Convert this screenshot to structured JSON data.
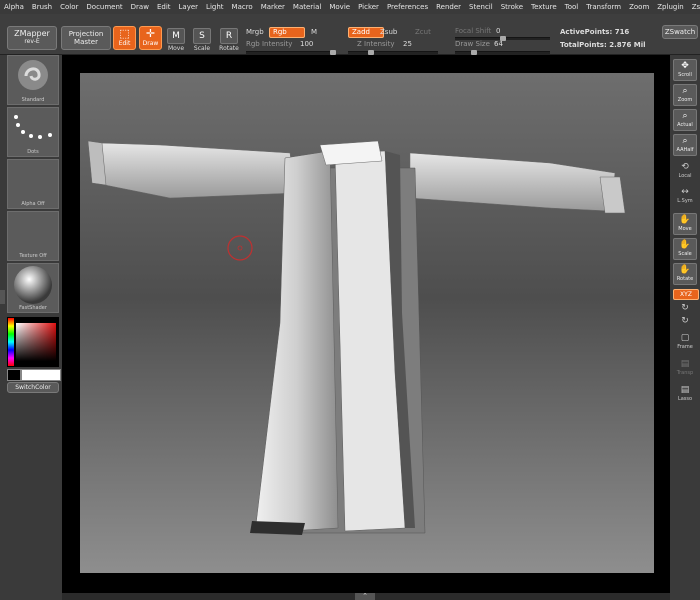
{
  "menu": [
    "Alpha",
    "Brush",
    "Color",
    "Document",
    "Draw",
    "Edit",
    "Layer",
    "Light",
    "Macro",
    "Marker",
    "Material",
    "Movie",
    "Picker",
    "Preferences",
    "Render",
    "Stencil",
    "Stroke",
    "Texture",
    "Tool",
    "Transform",
    "Zoom",
    "Zplugin",
    "Zscript"
  ],
  "toolbar": {
    "zmapper": "ZMapper",
    "zmapper_sub": "rev-E",
    "projection": "Projection",
    "projection_sub": "Master",
    "edit": "Edit",
    "draw": "Draw",
    "move": "Move",
    "scale": "Scale",
    "rotate": "Rotate",
    "mrgb": "Mrgb",
    "rgb": "Rgb",
    "m": "M",
    "rgb_intensity_label": "Rgb Intensity",
    "rgb_intensity_value": "100",
    "rgb_intensity_level": 1.0,
    "zadd": "Zadd",
    "zsub": "Zsub",
    "zcut": "Zcut",
    "z_intensity_label": "Z Intensity",
    "z_intensity_value": "25",
    "z_intensity_level": 0.25,
    "focal_shift_label": "Focal Shift",
    "focal_shift_value": "0",
    "focal_shift_level": 0.5,
    "draw_size_label": "Draw Size",
    "draw_size_value": "64",
    "draw_size_level": 0.2,
    "active_points": "ActivePoints: 716",
    "total_points": "TotalPoints: 2.876 Mil",
    "zswatch": "ZSwatch"
  },
  "left": {
    "standard": "Standard",
    "dots": "Dots",
    "alpha_off": "Alpha Off",
    "texture_off": "Texture Off",
    "fastshader": "FastShader",
    "switchcolor": "SwitchColor"
  },
  "right": {
    "scroll": "Scroll",
    "zoom": "Zoom",
    "actual": "Actual",
    "aahalf": "AAHalf",
    "local": "Local",
    "lsym": "L.Sym",
    "move": "Move",
    "scale": "Scale",
    "rotate": "Rotate",
    "xyz": "XYZ",
    "frame": "Frame",
    "transp": "Transp",
    "lasso": "Lasso"
  },
  "colors": {
    "accent": "#e8641c",
    "panel": "#3a3a3a",
    "brush_cursor": "#c03030"
  }
}
